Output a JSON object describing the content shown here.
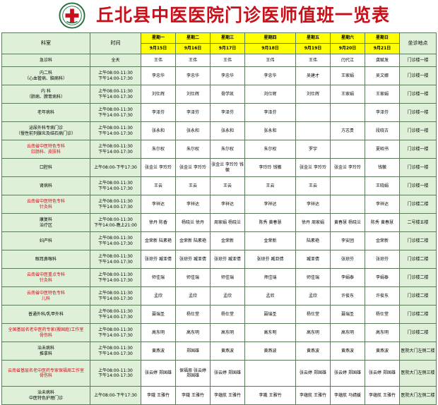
{
  "title": "丘北县中医医院门诊医师值班一览表",
  "header": {
    "dept": "科室",
    "time": "时间",
    "location": "坐诊地点",
    "days": [
      {
        "name": "星期一",
        "date": "9月15日"
      },
      {
        "name": "星期二",
        "date": "9月16日"
      },
      {
        "name": "星期三",
        "date": "9月17日"
      },
      {
        "name": "星期四",
        "date": "9月18日"
      },
      {
        "name": "星期五",
        "date": "9月19日"
      },
      {
        "name": "星期六",
        "date": "9月20日"
      },
      {
        "name": "星期日",
        "date": "9月21日"
      }
    ]
  },
  "rows": [
    {
      "dept": "急诊科",
      "red": false,
      "time": "全天",
      "cells": [
        "王伟",
        "王伟",
        "王伟",
        "王伟",
        "王伟",
        "闫代江",
        "龚赋发"
      ],
      "loc": "门诊楼一楼"
    },
    {
      "dept": "内二科\n（心血管病、脑病科）",
      "red": false,
      "time": "上午08:00-11:30\n下午14:00-17:30",
      "cells": [
        "李忠华",
        "李忠华",
        "李忠华",
        "李忠华",
        "吴建才",
        "王家娟",
        "吴文娜"
      ],
      "loc": "门诊楼一楼"
    },
    {
      "dept": "内 科\n（肺病、脾胃病科）",
      "red": false,
      "time": "上午08:00-11:30\n下午14:00-17:30",
      "cells": [
        "刘仕辉",
        "刘仕辉",
        "骨学凯",
        "刘仕辉",
        "刘仕辉",
        "王家娟",
        "王家娟"
      ],
      "loc": "门诊楼一楼"
    },
    {
      "dept": "老年病科",
      "red": false,
      "time": "上午08:00-11:30\n下午14:00-17:30",
      "cells": [
        "李泽芬",
        "李泽芬",
        "李泽芬",
        "李泽芬",
        "",
        "",
        "李泽芬"
      ],
      "loc": "门诊楼一楼"
    },
    {
      "dept": "泌尿外科专病门诊\n（慢性前列腺炎及结石病门诊）",
      "red": false,
      "time": "上午08:00-11:30\n下午14:00-17:30",
      "cells": [
        "张永和",
        "张永和",
        "张永和",
        "张永和",
        "",
        "方志贵",
        "段晓古"
      ],
      "loc": "门诊楼一楼"
    },
    {
      "dept": "云南省中医特色专科\n肛肠科、皮肤科",
      "red": true,
      "time": "上午08:00-11:30\n下午14:00-17:30",
      "cells": [
        "朱尔权",
        "朱尔权",
        "朱尔权",
        "朱尔权",
        "罗宇",
        "",
        "夏昭书"
      ],
      "loc": "门诊楼一楼"
    },
    {
      "dept": "口腔科",
      "red": false,
      "time": "上午08:00-下午17:30",
      "cells": [
        "张金兰 李玲玲",
        "张金兰 李玲玲",
        "张金兰 李玲玲 钱徽",
        "李玲玲 钱徽",
        "张金兰 李玲玲",
        "张金兰 李玲玲",
        "钱徽"
      ],
      "loc": "门诊楼一楼"
    },
    {
      "dept": "肾病科",
      "red": false,
      "time": "上午08:00-11:30\n下午14:00-17:30",
      "cells": [
        "王云",
        "王云",
        "王云",
        "王云",
        "王云",
        "",
        "王晓娟"
      ],
      "loc": "门诊楼一楼"
    },
    {
      "dept": "云南省中医特色专科\n针灸科",
      "red": true,
      "time": "上午08:00-11:30\n下午14:00-17:30",
      "cells": [
        "李祥达",
        "李祥达",
        "李祥达",
        "李祥达",
        "李祥达",
        "",
        "李祥达"
      ],
      "loc": "门诊楼二楼"
    },
    {
      "dept": "康复科\n治疗区",
      "red": false,
      "time": "上午08:00-11:30\n下午14:00-晚上21:00",
      "cells": [
        "徐丹 陈香",
        "杨晓兰 徐丹",
        "周家娟 杨晓兰",
        "陈秀 黄春慧",
        "徐丹 周家娟",
        "黄春慧 杨晓兰",
        "陈秀 黄春慧"
      ],
      "loc": "二号楼五楼"
    },
    {
      "dept": "妇产科",
      "red": false,
      "time": "上午08:00-11:30\n下午14:00-17:30",
      "cells": [
        "金荣新 陆素艳",
        "金荣新 陆素艳",
        "金荣新",
        "金荣新",
        "陆素艳",
        "李安团",
        "金荣新"
      ],
      "loc": "门诊楼二楼"
    },
    {
      "dept": "眼耳鼻喉科",
      "red": false,
      "time": "上午08:00-11:30\n下午14:00-17:30",
      "cells": [
        "张琼芬 臧亚倩",
        "张琼芬 臧亚倩",
        "张琼芬 臧亚倩",
        "张琼芬 臧亚倩",
        "臧亚倩",
        "张琼芬",
        "张琼芬"
      ],
      "loc": "门诊楼二楼"
    },
    {
      "dept": "云南省中医重点专科\n针灸科",
      "red": true,
      "time": "上午08:00-11:30\n下午14:00-17:30",
      "cells": [
        "师佳瑞",
        "师佳瑞",
        "师佳瑞",
        "师佳瑞",
        "师佳瑞",
        "李娟泰",
        "李娟泰"
      ],
      "loc": "门诊楼二楼"
    },
    {
      "dept": "云南省中医特色专科\n儿科",
      "red": true,
      "time": "上午08:00-11:30\n下午14:00-17:30",
      "cells": [
        "孟欣",
        "孟欣",
        "孟欣",
        "孟欣",
        "孟欣",
        "许俊东",
        "许俊东"
      ],
      "loc": "门诊楼二楼"
    },
    {
      "dept": "普通外科/乳甲外科",
      "red": false,
      "time": "上午08:00-11:30\n下午14:00-17:30",
      "cells": [
        "聂瑞圣",
        "杨仕堂",
        "杨仕堂",
        "聂瑞圣",
        "杨仕堂",
        "聂瑞圣",
        "杨仕堂"
      ],
      "loc": "门诊楼二楼"
    },
    {
      "dept": "全国基层名老中医药专家(搬国庭)工作室\n骨伤科",
      "red": true,
      "time": "上午08:00-11:30\n下午14:00-17:30",
      "cells": [
        "高东明",
        "高东明",
        "高东明",
        "高东明",
        "高东明",
        "高东明",
        "高东明"
      ],
      "loc": "门诊楼二楼"
    },
    {
      "dept": "治未病科\n推拿科",
      "red": false,
      "time": "上午08:00-11:30\n下午14:00-17:30",
      "cells": [
        "黄燕波",
        "郑国雄",
        "黄燕波",
        "黄燕波",
        "黄燕波",
        "黄燕波",
        "黄燕波"
      ],
      "loc": "医院大门左侧二楼"
    },
    {
      "dept": "云南省基层名老中医药专家保福周工作室\n骨伤科",
      "red": true,
      "time": "上午08:00-11:30\n下午14:00-17:30",
      "cells": [
        "张云婷 郑国雄",
        "保福周 张云婷\n郑国雄",
        "张云婷 郑国雄",
        "",
        "张云婷 郑国雄",
        "张云婷 郑国雄",
        "张云婷 郑国雄"
      ],
      "loc": "医院大门左侧三楼"
    },
    {
      "dept": "治未病科\n中医特色护理门诊",
      "red": false,
      "time": "上午08:00-下午17:30",
      "cells": [
        "李娥 王雅竹",
        "李娥 王雅竹",
        "李蕴航 王雅竹",
        "李娥 王雅竹",
        "李蕴航 王雅竹",
        "李蕴航 马婧媛",
        "李蕴航 王雅竹"
      ],
      "loc": "医院大门左侧二楼"
    }
  ]
}
